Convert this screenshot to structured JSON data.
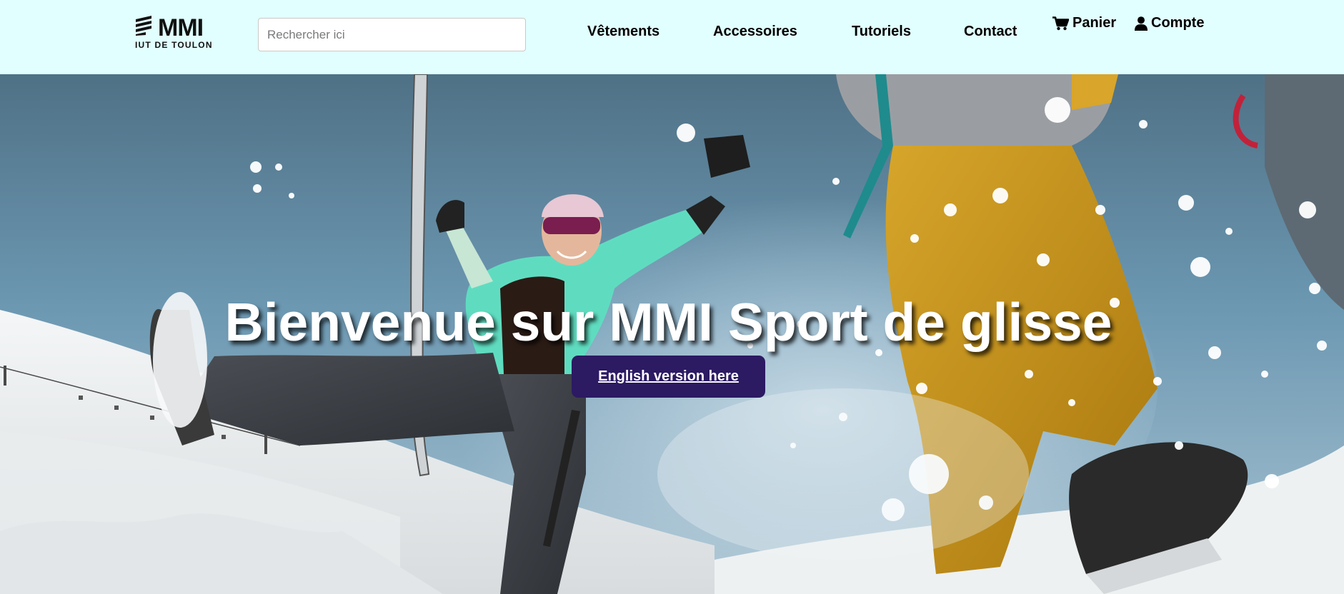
{
  "header": {
    "logo": {
      "brand": "MMI",
      "subtitle": "IUT DE TOULON"
    },
    "search": {
      "placeholder": "Rechercher ici",
      "value": ""
    },
    "nav": [
      {
        "label": "Vêtements"
      },
      {
        "label": "Accessoires"
      },
      {
        "label": "Tutoriels"
      },
      {
        "label": "Contact"
      }
    ],
    "utility": {
      "cart": {
        "label": "Panier",
        "icon": "cart-icon"
      },
      "account": {
        "label": "Compte",
        "icon": "user-icon"
      }
    }
  },
  "hero": {
    "title": "Bienvenue sur MMI Sport de glisse",
    "button_label": "English version here",
    "image_alt_icon": "skiers-jumping-in-snow"
  },
  "colors": {
    "header_bg": "#e1fffe",
    "button_bg": "#2c1a63",
    "sky": "#5f8eaa",
    "jacket_mint": "#5fdcc0",
    "pants_yellow": "#c9971c"
  }
}
